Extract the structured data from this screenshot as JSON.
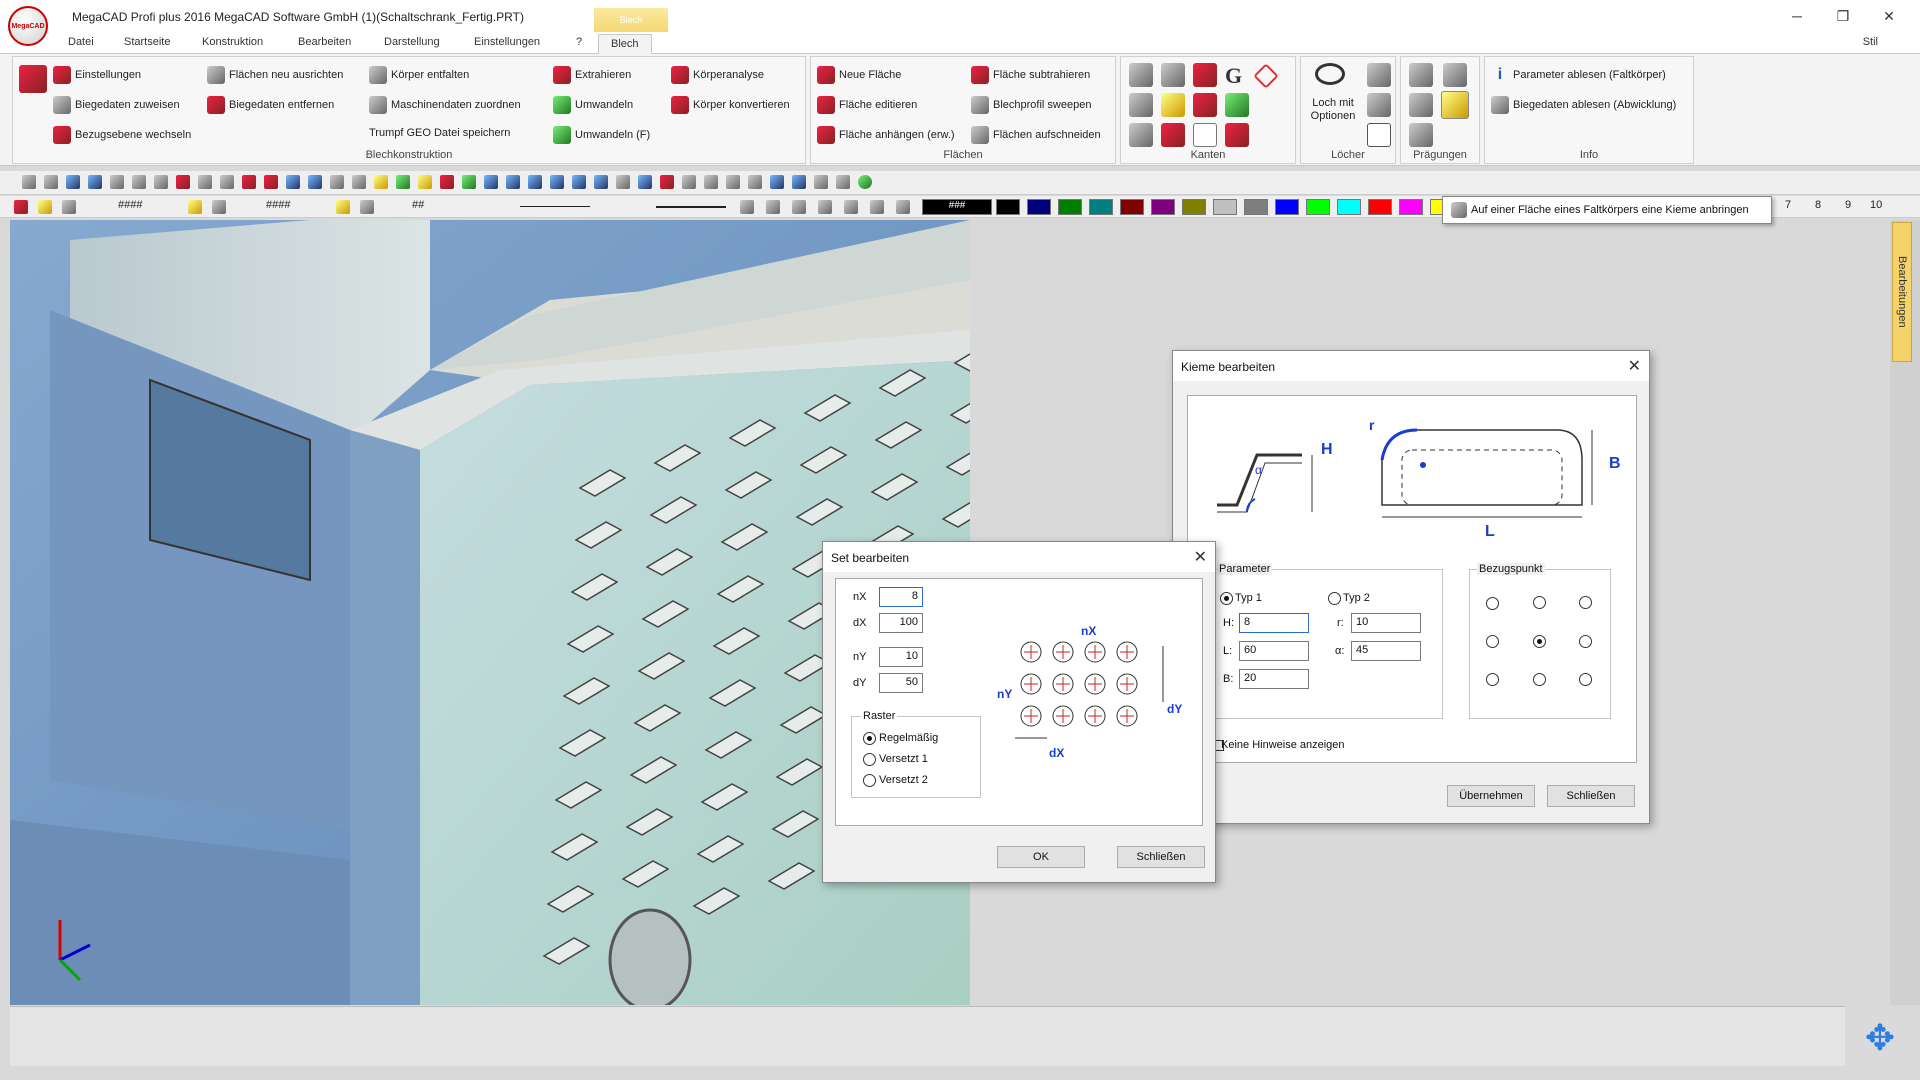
{
  "window": {
    "title": "MegaCAD Profi plus 2016  MegaCAD Software GmbH (1)(Schaltschrank_Fertig.PRT)",
    "logo_text": "MegaCAD",
    "context_tab": "Blech",
    "min": "─",
    "max": "❐",
    "close": "✕"
  },
  "menu": {
    "tabs": [
      "Datei",
      "Startseite",
      "Konstruktion",
      "Bearbeiten",
      "Darstellung",
      "Einstellungen",
      "?",
      "Blech"
    ],
    "active": "Blech",
    "style": "Stil"
  },
  "ribbon": {
    "blechkonstruktion": {
      "label": "Blechkonstruktion",
      "items": [
        "Einstellungen",
        "Biegedaten zuweisen",
        "Bezugsebene wechseln",
        "Flächen neu ausrichten",
        "Biegedaten entfernen",
        "Körper entfalten",
        "Maschinendaten zuordnen",
        "Trumpf GEO Datei speichern",
        "Extrahieren",
        "Umwandeln",
        "Umwandeln (F)",
        "Körperanalyse",
        "Körper konvertieren"
      ]
    },
    "flaechen": {
      "label": "Flächen",
      "items": [
        "Neue Fläche",
        "Fläche editieren",
        "Fläche anhängen (erw.)",
        "Fläche subtrahieren",
        "Blechprofil sweepen",
        "Flächen aufschneiden"
      ]
    },
    "kanten": {
      "label": "Kanten"
    },
    "loecher": {
      "label": "Löcher",
      "button": "Loch mit Optionen"
    },
    "praegungen": {
      "label": "Prägungen"
    },
    "info": {
      "label": "Info",
      "items": [
        "Parameter  ablesen (Faltkörper)",
        "Biegedaten ablesen (Abwicklung)"
      ]
    }
  },
  "toolbar": {
    "hash1": "####",
    "hash2": "####",
    "hash3": "##",
    "palette_label": "###",
    "numbers": [
      "7",
      "8",
      "9",
      "10"
    ],
    "palette": [
      "#000000",
      "#00007f",
      "#007f00",
      "#007f7f",
      "#7f0000",
      "#7f007f",
      "#7f7f00",
      "#c0c0c0",
      "#7f7f7f",
      "#0000ff",
      "#00ff00",
      "#00ffff",
      "#ff0000",
      "#ff00ff",
      "#ffff00"
    ]
  },
  "tooltip": "Auf einer Fläche eines Faltkörpers eine Kieme anbringen",
  "side_tab": "Bearbeitungen",
  "kieme": {
    "title": "Kieme bearbeiten",
    "param_group": "Parameter",
    "typ1": "Typ 1",
    "typ2": "Typ 2",
    "h_label": "H:",
    "h_value": "8",
    "l_label": "L:",
    "l_value": "60",
    "b_label": "B:",
    "b_value": "20",
    "r_label": "r:",
    "r_value": "10",
    "a_label": "α:",
    "a_value": "45",
    "ref_group": "Bezugspunkt",
    "no_hints": "Keine Hinweise anzeigen",
    "apply": "Übernehmen",
    "close": "Schließen",
    "diagram": {
      "H": "H",
      "B": "B",
      "L": "L",
      "r": "r",
      "alpha": "α"
    }
  },
  "set": {
    "title": "Set bearbeiten",
    "nx_label": "nX",
    "nx_value": "8",
    "dx_label": "dX",
    "dx_value": "100",
    "ny_label": "nY",
    "ny_value": "10",
    "dy_label": "dY",
    "dy_value": "50",
    "raster_group": "Raster",
    "opt1": "Regelmäßig",
    "opt2": "Versetzt 1",
    "opt3": "Versetzt 2",
    "ok": "OK",
    "close": "Schließen",
    "diagram": {
      "nX": "nX",
      "nY": "nY",
      "dX": "dX",
      "dY": "dY"
    }
  }
}
